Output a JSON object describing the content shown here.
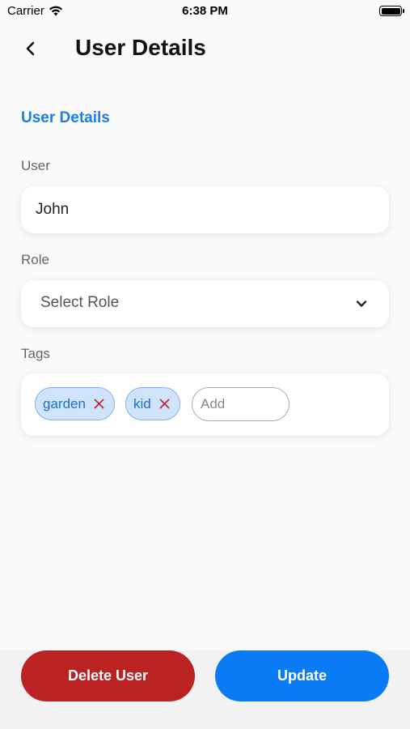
{
  "status_bar": {
    "carrier": "Carrier",
    "time": "6:38 PM"
  },
  "nav": {
    "title": "User Details",
    "back_icon": "chevron-left-icon"
  },
  "form": {
    "section_title": "User Details",
    "user": {
      "label": "User",
      "value": "John"
    },
    "role": {
      "label": "Role",
      "placeholder": "Select Role"
    },
    "tags": {
      "label": "Tags",
      "items": [
        {
          "label": "garden"
        },
        {
          "label": "kid"
        }
      ],
      "add_placeholder": "Add"
    }
  },
  "actions": {
    "delete_label": "Delete User",
    "update_label": "Update"
  },
  "colors": {
    "accent": "#1a7ee6",
    "delete": "#bb2222",
    "update": "#0a7bf5",
    "tag_bg": "#cfe3fa",
    "tag_remove": "#c0283a"
  }
}
